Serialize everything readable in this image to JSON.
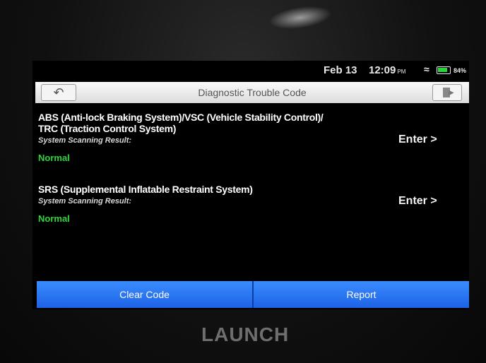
{
  "status": {
    "date": "Feb 13",
    "time": "12:09",
    "ampm": "PM",
    "battery_pct": "84%",
    "battery_level": 0.84
  },
  "header": {
    "title": "Diagnostic Trouble Code",
    "back_icon": "back-arrow-icon",
    "exit_icon": "exit-icon"
  },
  "systems": [
    {
      "name_line1": "ABS (Anti-lock Braking System)/VSC (Vehicle Stability Control)/",
      "name_line2": "TRC (Traction Control System)",
      "label": "System Scanning Result:",
      "result": "Normal",
      "enter_label": "Enter"
    },
    {
      "name_line1": "SRS (Supplemental Inflatable Restraint System)",
      "label": "System Scanning Result:",
      "result": "Normal",
      "enter_label": "Enter"
    }
  ],
  "footer": {
    "clear_label": "Clear Code",
    "report_label": "Report"
  },
  "device": {
    "brand": "LAUNCH"
  },
  "colors": {
    "accent_blue": "#2f7cf6",
    "normal_green": "#2fd53c",
    "battery_green": "#29d33a"
  }
}
